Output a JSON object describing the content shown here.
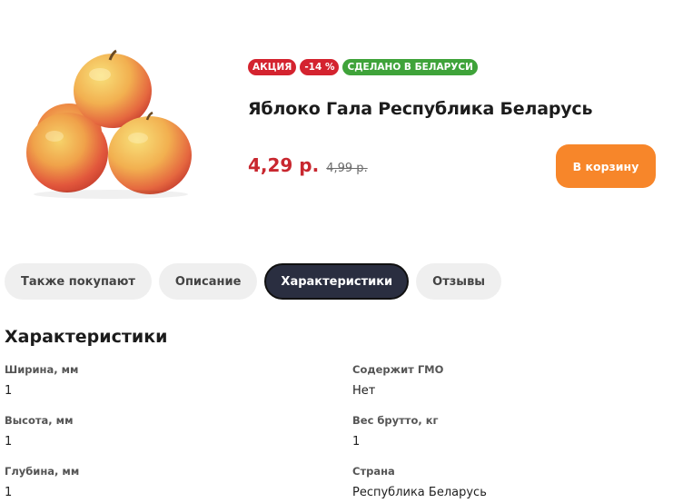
{
  "product": {
    "badges": {
      "sale": "АКЦИЯ",
      "discount": "-14 %",
      "made_in": "СДЕЛАНО В БЕЛАРУСИ"
    },
    "title": "Яблоко Гала Республика Беларусь",
    "price_current": "4,29 р.",
    "price_old": "4,99 р.",
    "cart_button": "В корзину"
  },
  "tabs": [
    {
      "label": "Также покупают",
      "active": false
    },
    {
      "label": "Описание",
      "active": false
    },
    {
      "label": "Характеристики",
      "active": true
    },
    {
      "label": "Отзывы",
      "active": false
    }
  ],
  "specs": {
    "title": "Характеристики",
    "items": [
      {
        "label": "Ширина, мм",
        "value": "1"
      },
      {
        "label": "Содержит ГМО",
        "value": "Нет"
      },
      {
        "label": "Высота, мм",
        "value": "1"
      },
      {
        "label": "Вес брутто, кг",
        "value": "1"
      },
      {
        "label": "Глубина, мм",
        "value": "1"
      },
      {
        "label": "Страна",
        "value": "Республика Беларусь"
      }
    ]
  },
  "colors": {
    "sale_badge": "#d4232f",
    "made_in_badge": "#3fa33a",
    "price": "#c8272f",
    "cart_button": "#f7862a",
    "active_tab": "#2a2e40"
  }
}
